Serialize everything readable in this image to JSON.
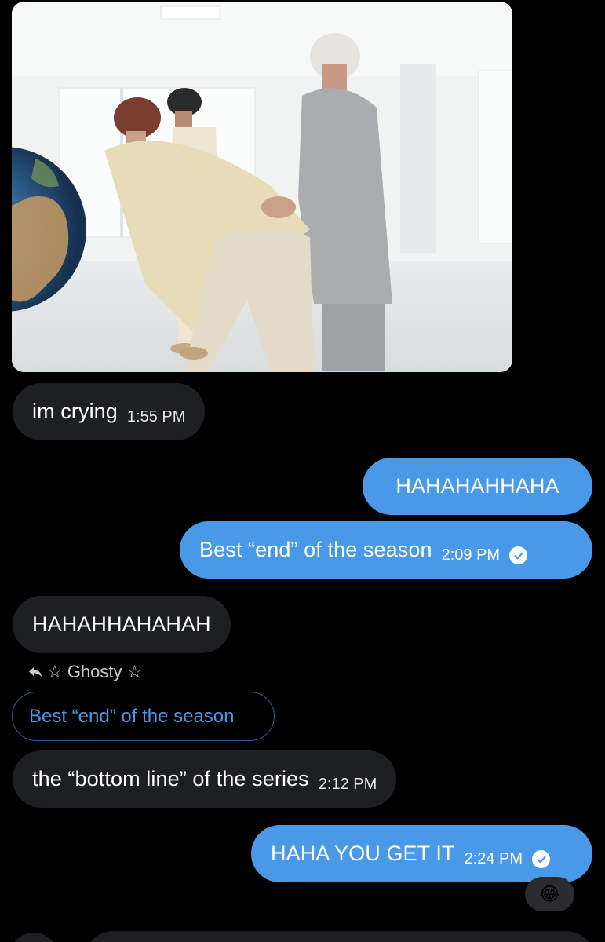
{
  "messages": {
    "m1": {
      "text": "im crying",
      "time": "1:55 PM"
    },
    "m2": {
      "text": "HAHAHAHHAHA"
    },
    "m3": {
      "text": "Best “end” of the season",
      "time": "2:09 PM"
    },
    "m4": {
      "text": "HAHAHHAHAHAH"
    },
    "reply": {
      "author": "☆ Ghosty ☆",
      "quoted_text": "Best “end” of the season"
    },
    "m5": {
      "text": "the “bottom line” of the series",
      "time": "2:12 PM"
    },
    "m6": {
      "text": "HAHA YOU GET IT",
      "time": "2:24 PM",
      "reaction": "😂"
    }
  },
  "colors": {
    "background": "#000000",
    "received_bubble": "#1d1f23",
    "sent_bubble": "#4a99e9",
    "quote_text": "#4a99e9"
  },
  "icons": [
    "reply-arrow-icon",
    "read-check-icon",
    "laughing-emoji-reaction"
  ]
}
